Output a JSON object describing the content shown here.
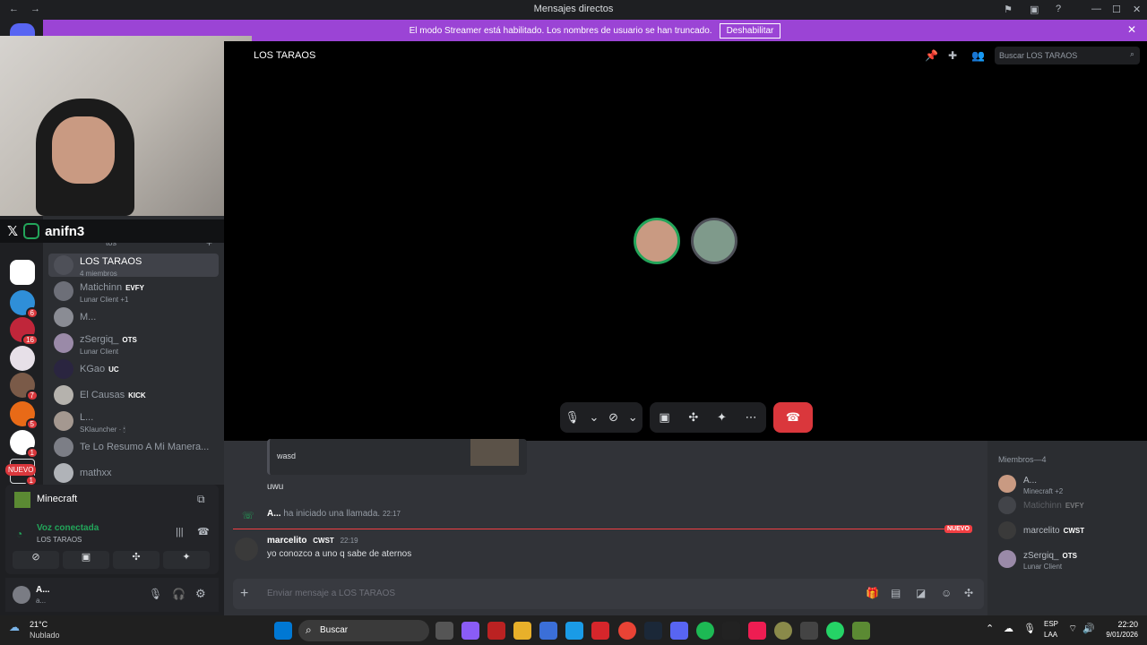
{
  "window": {
    "title": "Mensajes directos"
  },
  "banner": {
    "text": "El modo Streamer está habilitado. Los nombres de usuario se han truncado.",
    "button": "Deshabilitar"
  },
  "social": {
    "handle": "anifn3"
  },
  "dm_section": {
    "header": "tos",
    "add": "+"
  },
  "servers": {
    "new_badge": "NUEVO",
    "badges": [
      "6",
      "16",
      "7",
      "5",
      "1",
      "1"
    ]
  },
  "dms": [
    {
      "name": "LOS TARAOS",
      "sub": "4 miembros"
    },
    {
      "name": "Matichinn",
      "tag": "EVFY",
      "sub": "Lunar Client +1"
    },
    {
      "name": "M..."
    },
    {
      "name": "zSergiq_",
      "tag": "OTS",
      "sub": "Lunar Client"
    },
    {
      "name": "KGao",
      "tag": "UC"
    },
    {
      "name": "El Causas",
      "tag": "KICK"
    },
    {
      "name": "L...",
      "sub": "SKlauncher · 🕯"
    },
    {
      "name": "Te Lo Resumo A Mi Manera..."
    },
    {
      "name": "mathxx"
    }
  ],
  "voice": {
    "activity": "Minecraft",
    "status": "Voz conectada",
    "channel": "LOS TARAOS"
  },
  "user": {
    "name": "A...",
    "sub": "a..."
  },
  "call": {
    "channel_title": "LOS TARAOS",
    "search_placeholder": "Buscar LOS TARAOS"
  },
  "chat": {
    "embed_text": "wasd",
    "msg_uwu": "uwu",
    "call_started_user": "A...",
    "call_started_text": "ha iniciado una llamada.",
    "call_started_time": "22:17",
    "new_label": "NUEVO",
    "message": {
      "author": "marcelito",
      "tag": "CWST",
      "time": "22:19",
      "text": "yo conozco a uno q sabe de aternos"
    },
    "input_placeholder": "Enviar mensaje a LOS TARAOS"
  },
  "members": {
    "header": "Miembros—4",
    "list": [
      {
        "name": "A...",
        "sub": "Minecraft +2"
      },
      {
        "name": "Matichinn",
        "tag": "EVFY"
      },
      {
        "name": "marcelito",
        "tag": "CWST"
      },
      {
        "name": "zSergiq_",
        "tag": "OTS",
        "sub": "Lunar Client"
      }
    ]
  },
  "taskbar": {
    "weather_temp": "21°C",
    "weather_desc": "Nublado",
    "search": "Buscar",
    "lang": "ESP",
    "lang2": "LAA",
    "time": "22:20",
    "date": "9/01/2026"
  },
  "colors": {
    "blurple": "#5865f2",
    "banner": "#9b44d5",
    "danger": "#da373c",
    "green": "#23a55a"
  }
}
